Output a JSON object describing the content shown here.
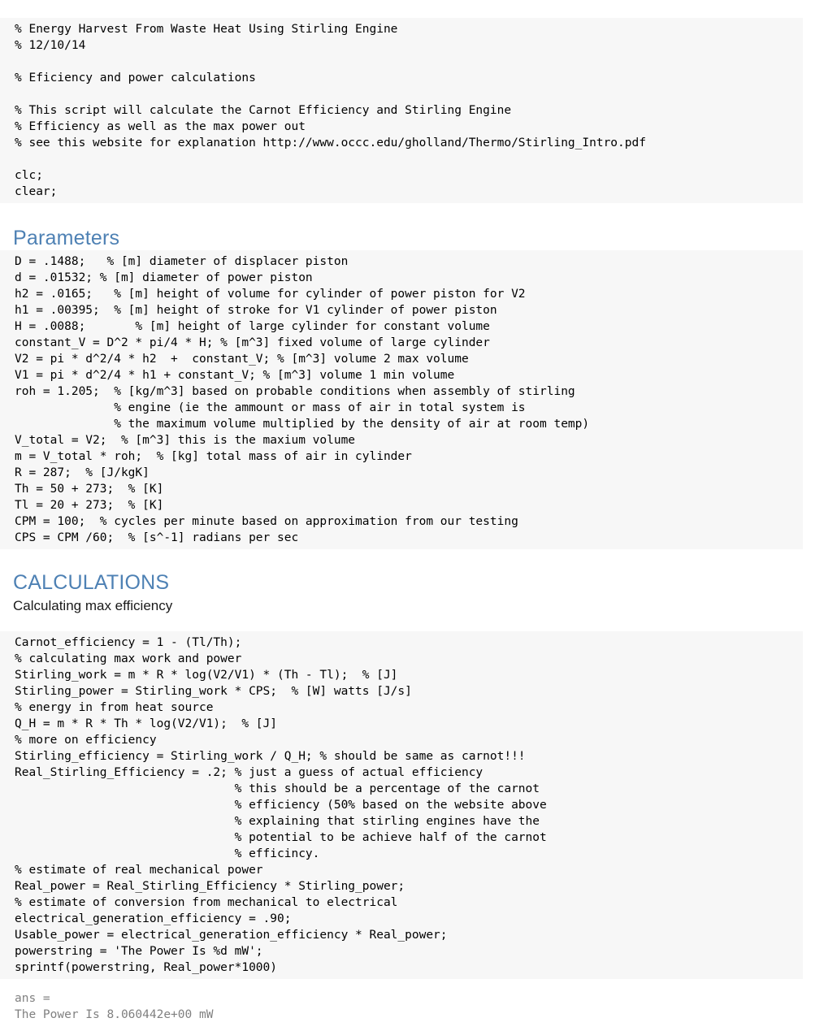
{
  "document": {
    "title": "Energy Harvest From Waste Heat Using Stirling Engine",
    "accent_color": "#4e81b4",
    "code_background": "#f7f7f7",
    "output_color": "#808080"
  },
  "intro_code": "% Energy Harvest From Waste Heat Using Stirling Engine\n% 12/10/14\n\n% Eficiency and power calculations\n\n% This script will calculate the Carnot Efficiency and Stirling Engine\n% Efficiency as well as the max power out\n% see this website for explanation http://www.occc.edu/gholland/Thermo/Stirling_Intro.pdf\n\nclc;\nclear;",
  "sections": [
    {
      "heading": "Parameters",
      "subheading": "",
      "code": "D = .1488;   % [m] diameter of displacer piston\nd = .01532; % [m] diameter of power piston\nh2 = .0165;   % [m] height of volume for cylinder of power piston for V2\nh1 = .00395;  % [m] height of stroke for V1 cylinder of power piston\nH = .0088;       % [m] height of large cylinder for constant volume\nconstant_V = D^2 * pi/4 * H; % [m^3] fixed volume of large cylinder\nV2 = pi * d^2/4 * h2  +  constant_V; % [m^3] volume 2 max volume\nV1 = pi * d^2/4 * h1 + constant_V; % [m^3] volume 1 min volume\nroh = 1.205;  % [kg/m^3] based on probable conditions when assembly of stirling\n              % engine (ie the ammount or mass of air in total system is\n              % the maximum volume multiplied by the density of air at room temp)\nV_total = V2;  % [m^3] this is the maxium volume\nm = V_total * roh;  % [kg] total mass of air in cylinder\nR = 287;  % [J/kgK]\nTh = 50 + 273;  % [K]\nTl = 20 + 273;  % [K]\nCPM = 100;  % cycles per minute based on approximation from our testing\nCPS = CPM /60;  % [s^-1] radians per sec"
    },
    {
      "heading": "CALCULATIONS",
      "subheading": "Calculating max efficiency",
      "code": "Carnot_efficiency = 1 - (Tl/Th);\n% calculating max work and power\nStirling_work = m * R * log(V2/V1) * (Th - Tl);  % [J]\nStirling_power = Stirling_work * CPS;  % [W] watts [J/s]\n% energy in from heat source\nQ_H = m * R * Th * log(V2/V1);  % [J]\n% more on efficiency\nStirling_efficiency = Stirling_work / Q_H; % should be same as carnot!!!\nReal_Stirling_Efficiency = .2; % just a guess of actual efficiency\n                               % this should be a percentage of the carnot\n                               % efficiency (50% based on the website above\n                               % explaining that stirling engines have the\n                               % potential to be achieve half of the carnot\n                               % efficincy.\n% estimate of real mechanical power\nReal_power = Real_Stirling_Efficiency * Stirling_power;\n% estimate of conversion from mechanical to electrical\nelectrical_generation_efficiency = .90;\nUsable_power = electrical_generation_efficiency * Real_power;\npowerstring = 'The Power Is %d mW';\nsprintf(powerstring, Real_power*1000)"
    }
  ],
  "console_output": "ans =\nThe Power Is 8.060442e+00 mW"
}
